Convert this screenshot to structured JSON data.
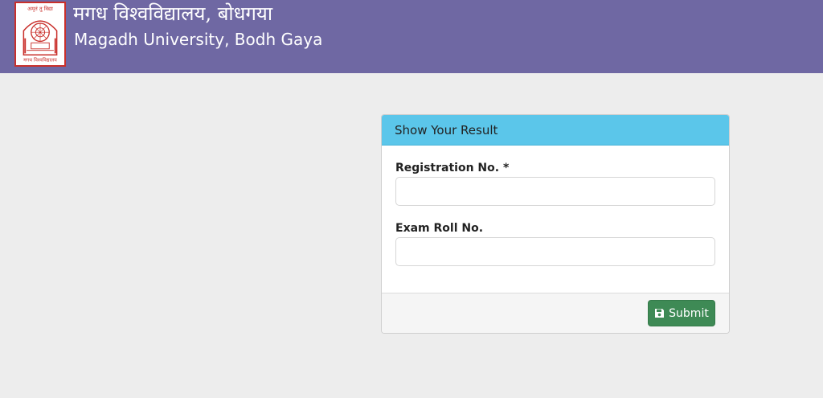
{
  "header": {
    "title_hindi": "मगध विश्वविद्यालय, बोधगया",
    "title_english": "Magadh University, Bodh Gaya",
    "background_color": "#6f68a3",
    "logo": {
      "icon": "university-seal-icon",
      "top_text": "अमृतं तु विद्या",
      "bottom_text": "मगध विश्वविद्यालय",
      "border_color": "#c9302c"
    }
  },
  "result_panel": {
    "heading": "Show Your Result",
    "heading_color": "#5bc6ea",
    "fields": [
      {
        "label": "Registration No. *",
        "value": "",
        "placeholder": ""
      },
      {
        "label": "Exam Roll No.",
        "value": "",
        "placeholder": ""
      }
    ],
    "submit": {
      "label": "Submit",
      "icon": "save-icon",
      "color": "#3e8a55"
    }
  }
}
